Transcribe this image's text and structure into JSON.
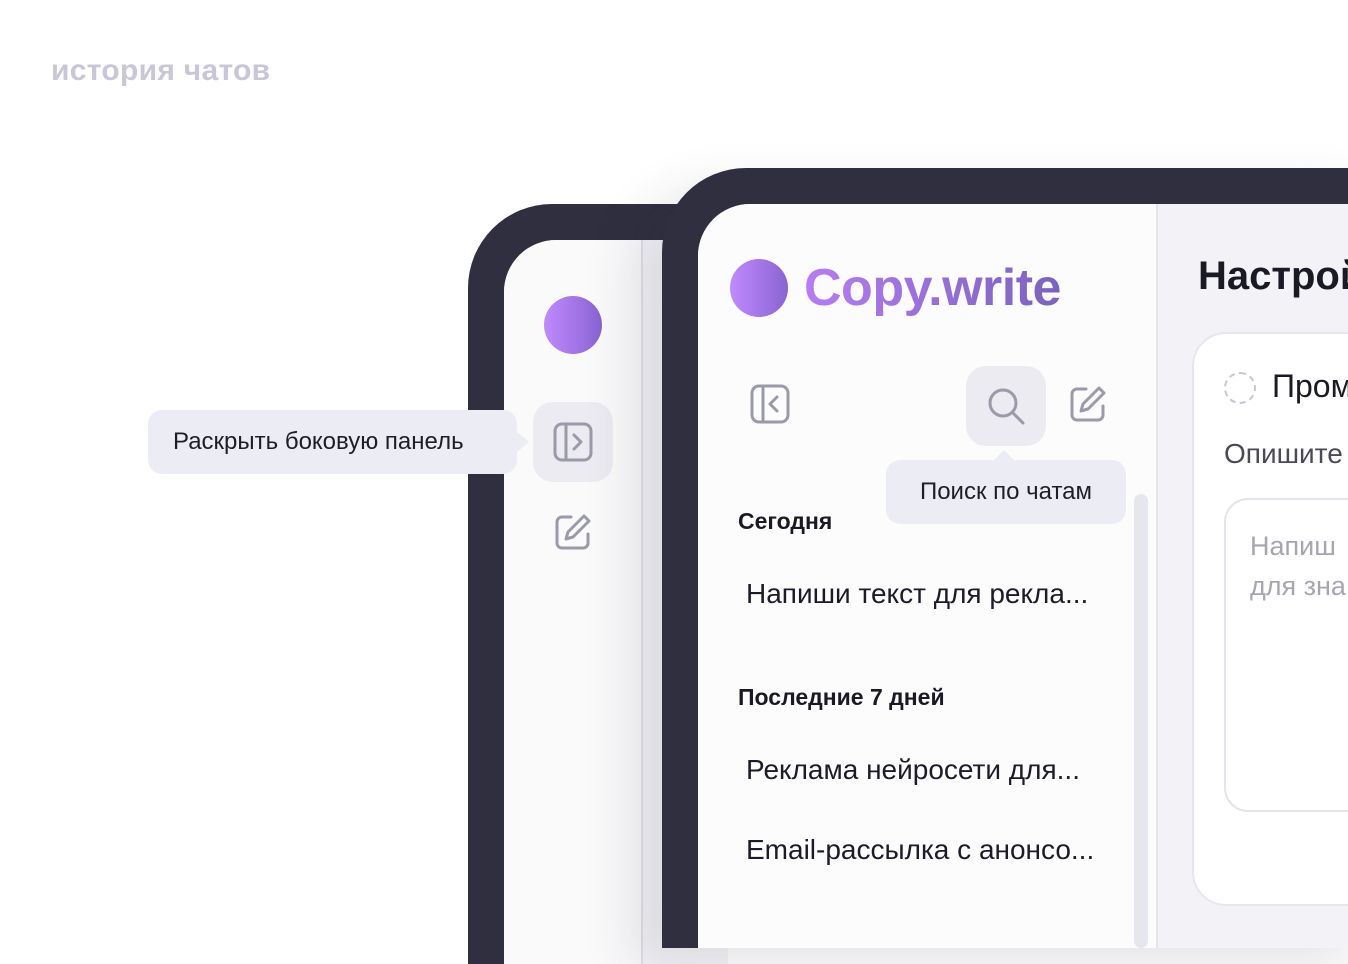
{
  "caption": "история чатов",
  "back_device": {
    "expand_tooltip": "Раскрыть боковую панель"
  },
  "app": {
    "brand": "Copy.write",
    "search_tooltip": "Поиск по чатам",
    "sections": [
      {
        "label": "Сегодня",
        "chats": [
          "Напиши текст для рекла..."
        ]
      },
      {
        "label": "Последние 7 дней",
        "chats": [
          "Реклама нейросети для...",
          "Email-рассылка с анонсо..."
        ]
      }
    ],
    "main_title": "Настрой",
    "card": {
      "title": "Пром",
      "label": "Опишите",
      "placeholder": "Напиш\nдля зна"
    }
  },
  "icons": {
    "expand": "sidebar-expand-icon",
    "collapse": "sidebar-collapse-icon",
    "search": "search-icon",
    "new_chat": "edit-icon"
  },
  "colors": {
    "frame": "#302f40",
    "accent_start": "#c08aff",
    "accent_end": "#8a63d2",
    "tooltip_bg": "#ececf4"
  }
}
